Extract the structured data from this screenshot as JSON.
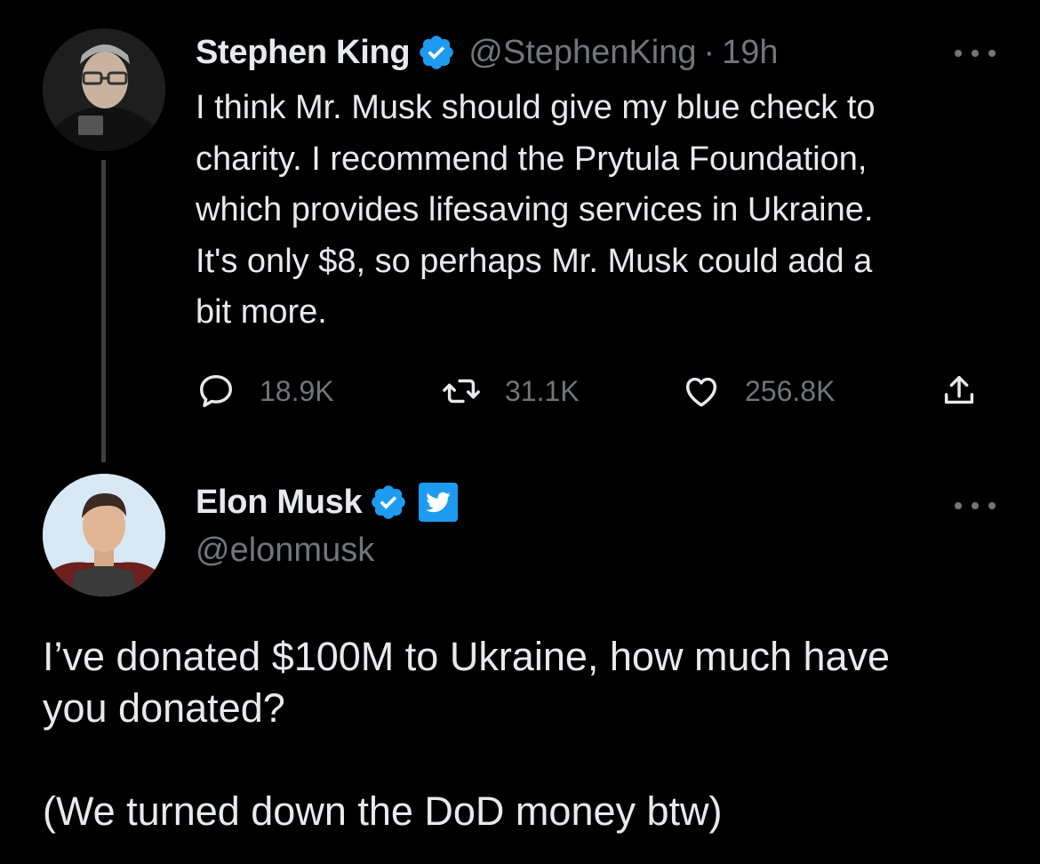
{
  "parent_tweet": {
    "display_name": "Stephen King",
    "handle": "@StephenKing",
    "separator": "·",
    "time": "19h",
    "text": "I think Mr. Musk should give my blue check to\ncharity. I recommend the Prytula Foundation,\nwhich provides lifesaving services in Ukraine.\nIt's only $8, so perhaps Mr. Musk could add a\nbit more.",
    "replies": "18.9K",
    "retweets": "31.1K",
    "likes": "256.8K",
    "avatar_icon": "person-avatar-icon"
  },
  "reply_tweet": {
    "display_name": "Elon Musk",
    "handle": "@elonmusk",
    "text_line1": "I’ve donated $100M to Ukraine, how much have\nyou donated?",
    "text_line2": "(We turned down the DoD money btw)",
    "avatar_icon": "person-avatar-icon",
    "affiliation_badge": "twitter-bird-icon"
  },
  "colors": {
    "background": "#000000",
    "text_primary": "#e7e9ea",
    "text_secondary": "#71767b",
    "verified_blue": "#1d9bf0",
    "thread_line": "#3b3f43"
  }
}
